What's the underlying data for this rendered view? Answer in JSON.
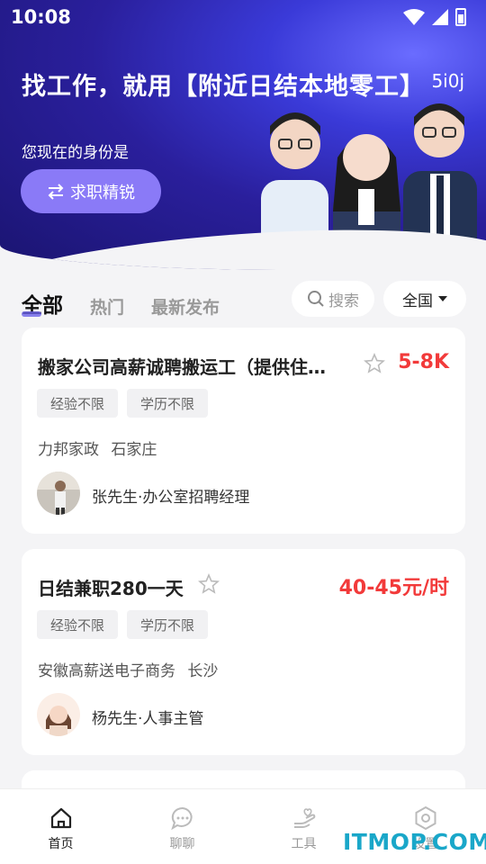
{
  "status_bar": {
    "time": "10:08"
  },
  "hero": {
    "title": "找工作，就用【附近日结本地零工】",
    "code": "5i0j",
    "identity_label": "您现在的身份是",
    "role_button": "求职精锐"
  },
  "tabs": [
    "全部",
    "热门",
    "最新发布"
  ],
  "search": {
    "placeholder": "搜索"
  },
  "region": {
    "label": "全国"
  },
  "jobs": [
    {
      "title": "搬家公司高薪诚聘搬运工（提供住…",
      "salary": "5-8K",
      "tags": [
        "经验不限",
        "学历不限"
      ],
      "company": "力邦家政",
      "city": "石家庄",
      "recruiter": "张先生·办公室招聘经理"
    },
    {
      "title": "日结兼职280一天",
      "salary": "40-45元/时",
      "tags": [
        "经验不限",
        "学历不限"
      ],
      "company": "安徽高薪送电子商务",
      "city": "长沙",
      "recruiter": "杨先生·人事主管"
    }
  ],
  "nav": [
    "首页",
    "聊聊",
    "工具",
    "设置"
  ],
  "watermark": "ITMOP.COM",
  "colors": {
    "accent": "#6b61e8",
    "salary": "#f23a3a",
    "role_button": "#8a7af7"
  }
}
